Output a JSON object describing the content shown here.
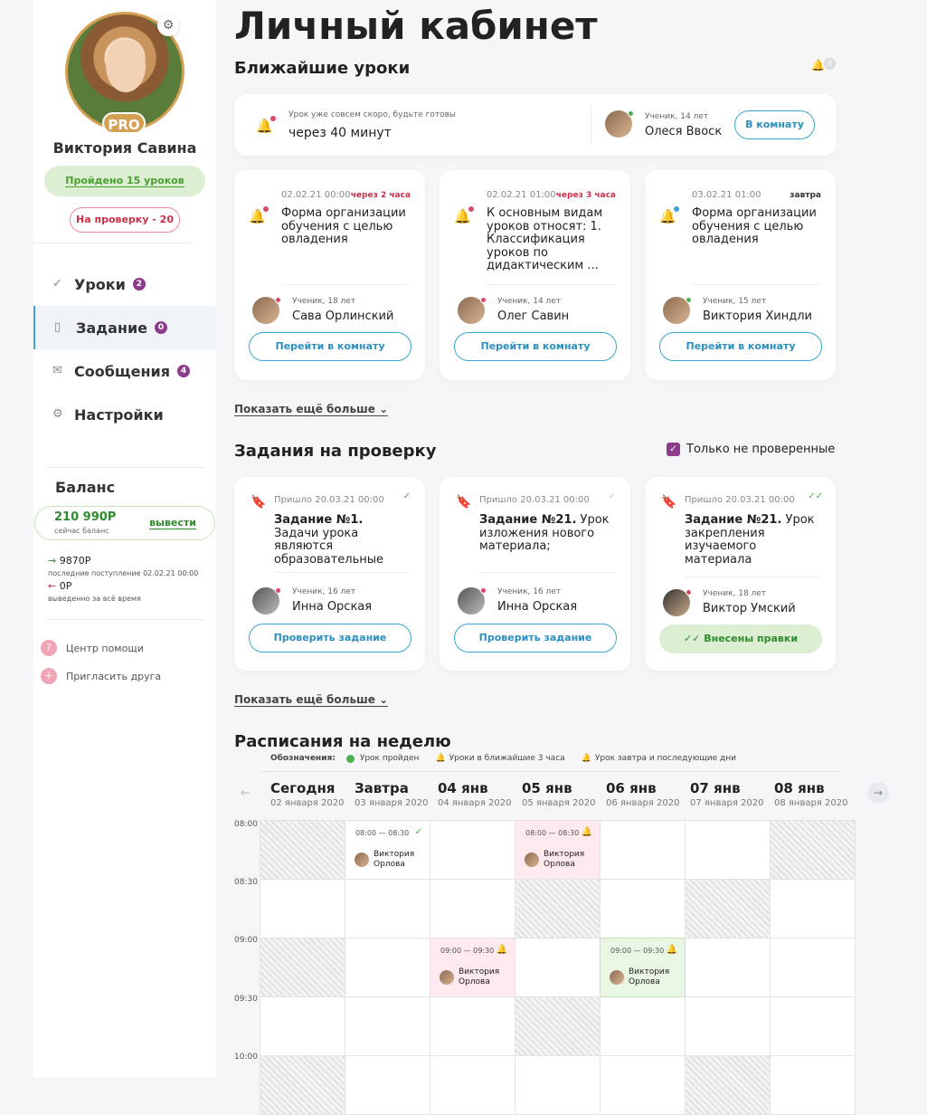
{
  "sidebar": {
    "user_name": "Виктория Савина",
    "pro_label": "PRO",
    "done_label": "Пройдено 15 уроков",
    "review_label": "На проверку - 20",
    "nav": [
      {
        "label": "Уроки",
        "count": "2"
      },
      {
        "label": "Задание",
        "count": "0"
      },
      {
        "label": "Сообщения",
        "count": "4"
      },
      {
        "label": "Настройки",
        "count": ""
      }
    ],
    "balance": {
      "title": "Баланс",
      "amount": "210 990Р",
      "amount_note": "сейчас баланс",
      "withdraw_label": "вывести",
      "last_in": "9870Р",
      "last_in_note": "последние поступление 02.02.21 00:00",
      "withdrawn": "0Р",
      "withdrawn_note": "выведенно за всё время"
    },
    "help": "Центр помощи",
    "invite": "Пригласить друга"
  },
  "main": {
    "title": "Личный кабинет",
    "upcoming_title": "Ближайшие уроки",
    "bell_count": "0",
    "next": {
      "hint": "Урок уже совсем скоро, будьте готовы",
      "time": "через 40 минут",
      "student_age": "Ученик, 14 лет",
      "student_name": "Олеся Ввоск",
      "button": "В комнату"
    },
    "lessons": [
      {
        "date": "02.02.21 00:00",
        "tag": "через 2 часа",
        "text": "Форма организации обучения с целью овладения",
        "age": "Ученик, 18 лет",
        "name": "Сава Орлинский",
        "button": "Перейти в комнату"
      },
      {
        "date": "02.02.21 01:00",
        "tag": "через 3 часа",
        "text": "К основным видам уроков относят: 1. Классификация уроков по дидактическим ...",
        "age": "Ученик, 14 лет",
        "name": "Олег Савин",
        "button": "Перейти в комнату"
      },
      {
        "date": "03.02.21 01:00",
        "tag": "завтра",
        "text": "Форма организации обучения с целью овладения",
        "age": "Ученик, 15 лет",
        "name": "Виктория Хиндли",
        "button": "Перейти в комнату"
      }
    ],
    "show_more": "Показать ещё больше",
    "tasks_title": "Задания на проверку",
    "only_unchecked": "Только не проверенные",
    "tasks": [
      {
        "came": "Пришло  20.03.21 00:00",
        "title": "Задание №1.",
        "text": " Задачи урока являются образовательные",
        "age": "Ученик, 16 лет",
        "name": "Инна Орская",
        "button": "Проверить задание"
      },
      {
        "came": "Пришло  20.03.21 00:00",
        "title": "Задание №21.",
        "text": " Урок изложения нового материала;",
        "age": "Ученик, 16 лет",
        "name": "Инна Орская",
        "button": "Проверить задание"
      },
      {
        "came": "Пришло  20.03.21 00:00",
        "title": "Задание №21.",
        "text": " Урок закрепления изучаемого материала",
        "age": "Ученик, 18 лет",
        "name": "Виктор Умский",
        "button": "Внесены правки"
      }
    ],
    "schedule_title": "Расписания на неделю",
    "legend": {
      "label": "Обозначения:",
      "done": "Урок пройден",
      "soon": "Уроки в ближайшие 3 часа",
      "later": "Урок завтра и последующие дни"
    },
    "days": [
      {
        "name": "Сегодня",
        "date": "02 января 2020"
      },
      {
        "name": "Завтра",
        "date": "03 января 2020"
      },
      {
        "name": "04 янв",
        "date": "04 января 2020"
      },
      {
        "name": "05 янв",
        "date": "05 января 2020"
      },
      {
        "name": "06 янв",
        "date": "06 января 2020"
      },
      {
        "name": "07 янв",
        "date": "07 января 2020"
      },
      {
        "name": "08 янв",
        "date": "08 января 2020"
      }
    ],
    "times": [
      "08:00",
      "08:30",
      "09:00",
      "09:30",
      "10:00"
    ],
    "events": [
      {
        "time": "08:00 — 08:30",
        "name": "Виктория Орлова"
      },
      {
        "time": "08:00 — 08:30",
        "name": "Виктория Орлова"
      },
      {
        "time": "09:00 — 09:30",
        "name": "Виктория Орлова"
      },
      {
        "time": "09:00 — 09:30",
        "name": "Виктория Орлова"
      }
    ]
  }
}
